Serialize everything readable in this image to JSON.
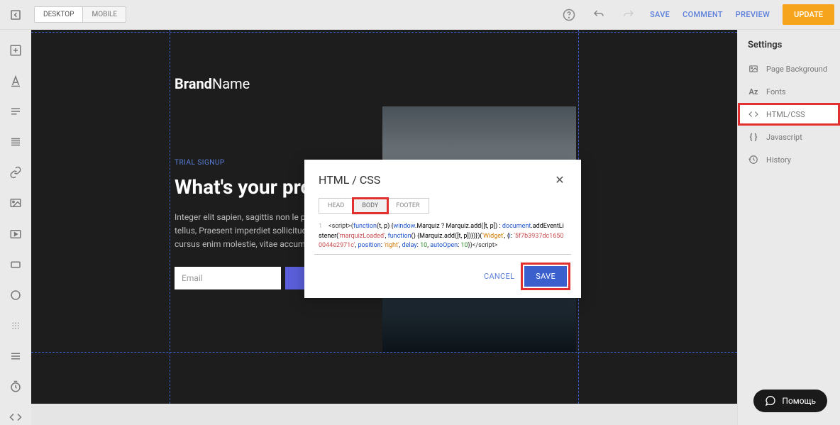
{
  "topbar": {
    "device_tabs": [
      "DESKTOP",
      "MOBILE"
    ],
    "save": "SAVE",
    "comment": "COMMENT",
    "preview": "PREVIEW",
    "update": "UPDATE"
  },
  "canvas": {
    "brand_bold": "Brand",
    "brand_light": "Name",
    "trial": "TRIAL SIGNUP",
    "headline": "What's your proposition?",
    "body": "Integer elit sapien, sagittis non le purus. Nam eget suscipit tellus, Praesent imperdiet sollicitudin tel gravida ut. Etiam non cursus enim molestie, vitae accumsan orci ma",
    "email_placeholder": "Email"
  },
  "panel": {
    "title": "Settings",
    "items": [
      {
        "label": "Page Background"
      },
      {
        "label": "Fonts"
      },
      {
        "label": "HTML/CSS"
      },
      {
        "label": "Javascript"
      },
      {
        "label": "History"
      }
    ]
  },
  "modal": {
    "title": "HTML / CSS",
    "tabs": [
      "HEAD",
      "BODY",
      "FOOTER"
    ],
    "cancel": "CANCEL",
    "save": "SAVE",
    "code": {
      "p1": "<script>",
      "p2": "(",
      "p3": "function",
      "p4": "(t, p) {",
      "p5": "window",
      "p6": ".Marquiz ? Marquiz.add([t, p]) : ",
      "p7": "document",
      "p8": ".addEventListener(",
      "p9": "'marquizLoaded'",
      "p10": ", ",
      "p11": "function",
      "p12": "() {Marquiz.add([t, p])})})(",
      "p13": "'Widget'",
      "p14": ", {",
      "p15": "i",
      "p16": ": ",
      "p17": "'5f7b3937dc16500044e2971c'",
      "p18": ", ",
      "p19": "position",
      "p20": ": ",
      "p21": "'right'",
      "p22": ", ",
      "p23": "delay",
      "p24": ": ",
      "p25": "10",
      "p26": ", ",
      "p27": "autoOpen",
      "p28": ": ",
      "p29": "10",
      "p30": "})</script>"
    }
  },
  "help": "Помощь"
}
